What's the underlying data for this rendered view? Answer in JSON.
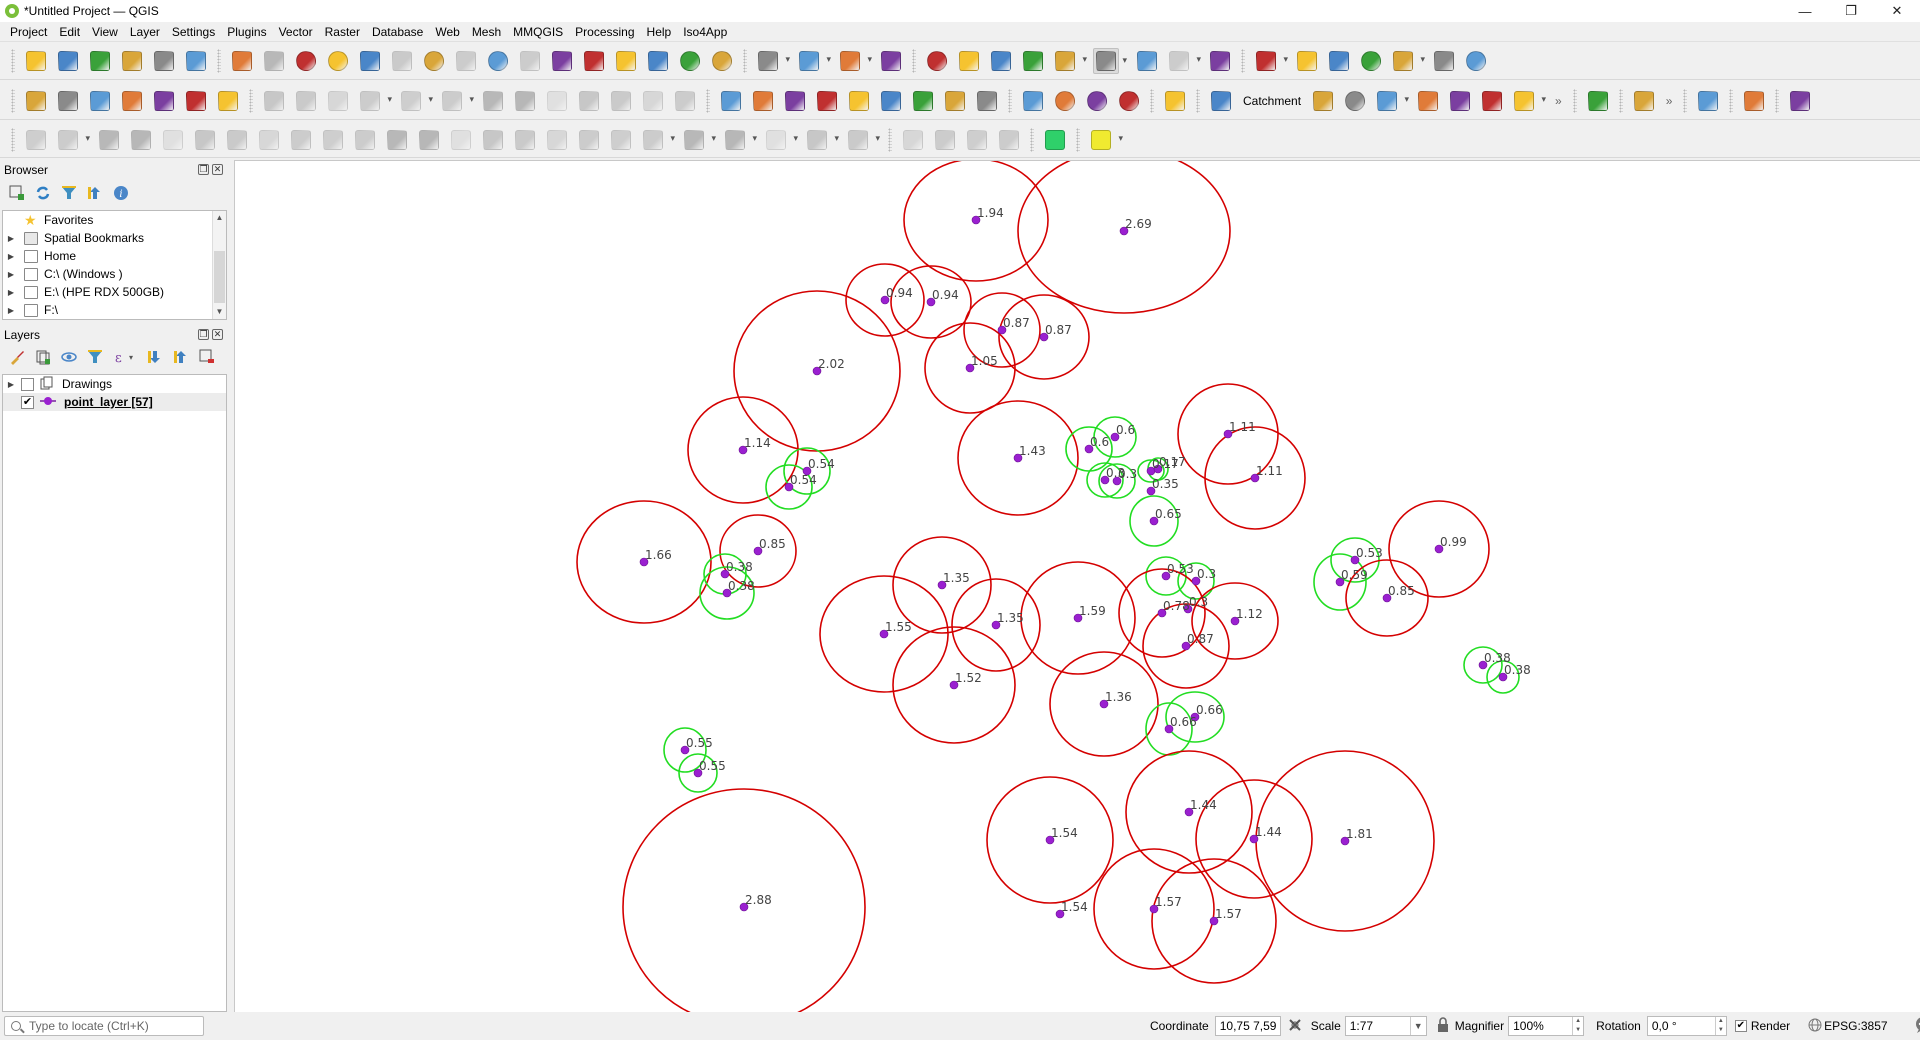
{
  "window": {
    "title": "*Untitled Project — QGIS",
    "controls": {
      "minimize": "—",
      "restore": "❐",
      "close": "✕"
    }
  },
  "menubar": [
    "Project",
    "Edit",
    "View",
    "Layer",
    "Settings",
    "Plugins",
    "Vector",
    "Raster",
    "Database",
    "Web",
    "Mesh",
    "MMQGIS",
    "Processing",
    "Help",
    "Iso4App"
  ],
  "toolbar": {
    "row1_icons": [
      "new-project",
      "open-project",
      "save-project",
      "new-print-layout",
      "layout-manager",
      "style-manager",
      "pan",
      "pan-to-selection",
      "zoom-in",
      "zoom-out",
      "zoom-full",
      "zoom-to-selection",
      "zoom-to-layer",
      "zoom-native",
      "zoom-last",
      "zoom-next",
      "new-map-view",
      "new-3d-map-view",
      "new-bookmark",
      "show-bookmarks",
      "temporal-controller",
      "refresh",
      "select-features",
      "select-by-expression",
      "deselect",
      "select-by-location",
      "identify",
      "open-attribute-table-calc",
      "processing-toolbox",
      "statistical-summary",
      "attribute-table",
      "measure-line",
      "map-tips",
      "locator-filter",
      "whats-this",
      "digitize-point",
      "digitize-line",
      "digitize-rectangle",
      "digitize-circle",
      "digitize-freehand",
      "digitize-polygon",
      "shape-settings"
    ],
    "row2_icons": [
      "data-source-manager",
      "new-geopackage",
      "new-shapefile",
      "new-spatialite",
      "new-virtual-layer",
      "new-temp-scratch",
      "new-mesh",
      "toggle-editing-disabled",
      "current-edits",
      "save-edits",
      "add-line",
      "add-polygon",
      "vertex-tool",
      "modify-attributes",
      "delete-selected",
      "cut",
      "copy",
      "paste",
      "undo",
      "redo",
      "layer-labeling",
      "layer-diagram",
      "pin-labels",
      "show-hide-labels",
      "highlight-pinned",
      "move-label",
      "rotate-label",
      "change-label",
      "label-properties",
      "digitize-polygon-red",
      "quickmapservices-add",
      "quickmapservices-search",
      "geocoding",
      "python-console",
      "catchment-plugin",
      "catchment-label",
      "osgeo-plugin",
      "timer",
      "measure-distance",
      "aggregate",
      "label-tool",
      "binoculars",
      "point-sampling",
      "more",
      "help-book",
      "topology-checker",
      "more2",
      "clipboard-layers",
      "hexagon-plugin",
      "plant-plugin"
    ],
    "catchment_label": "Catchment",
    "row3_icons": [
      "advanced-digitizing",
      "move-point",
      "reshape",
      "offset-curve",
      "rotate-feature",
      "simplify",
      "add-ring",
      "add-part",
      "fill-ring",
      "delete-ring",
      "delete-part",
      "split-features",
      "merge-attributes",
      "vertex-select",
      "split-parts",
      "cut-features",
      "cut-alt",
      "merge-features",
      "line-align",
      "rotate-point",
      "arc-tool",
      "circle-tool",
      "ellipse-tool",
      "rectangle-tool",
      "polygon-tool",
      "trim-extend",
      "reverse-line",
      "flip-tool",
      "delete-vertex",
      "green-shape",
      "layers-yellow"
    ]
  },
  "browser": {
    "title": "Browser",
    "items": [
      {
        "label": "Favorites",
        "icon": "star",
        "expandable": false
      },
      {
        "label": "Spatial Bookmarks",
        "icon": "bookmark",
        "expandable": true
      },
      {
        "label": "Home",
        "icon": "home-folder",
        "expandable": true
      },
      {
        "label": "C:\\ (Windows )",
        "icon": "folder",
        "expandable": true
      },
      {
        "label": "E:\\ (HPE RDX 500GB)",
        "icon": "folder",
        "expandable": true
      },
      {
        "label": "F:\\",
        "icon": "folder",
        "expandable": true
      }
    ]
  },
  "layers": {
    "title": "Layers",
    "items": [
      {
        "label": "Drawings",
        "checked": false,
        "icon": "group",
        "expandable": true
      },
      {
        "label": "point_layer [57]",
        "checked": true,
        "icon": "point-symbol",
        "expandable": false,
        "bold": true
      }
    ]
  },
  "map": {
    "colors": {
      "red_buffer": "#d40000",
      "green_buffer": "#22dd22",
      "point": "#9a20d0",
      "label": "#444444",
      "background": "#ffffff"
    },
    "threshold_note": "Points with value < 0.7 drawn with green buffers, others red",
    "points": [
      {
        "value": "1.94",
        "class": "red"
      },
      {
        "value": "2.69",
        "class": "red"
      },
      {
        "value": "0.94",
        "class": "red"
      },
      {
        "value": "0.94",
        "class": "red"
      },
      {
        "value": "0.87",
        "class": "red"
      },
      {
        "value": "0.87",
        "class": "red"
      },
      {
        "value": "2.02",
        "class": "red"
      },
      {
        "value": "1.05",
        "class": "red"
      },
      {
        "value": "1.14",
        "class": "red"
      },
      {
        "value": "0.54",
        "class": "green"
      },
      {
        "value": "0.54",
        "class": "green"
      },
      {
        "value": "1.43",
        "class": "red"
      },
      {
        "value": "0.6",
        "class": "green"
      },
      {
        "value": "0.6",
        "class": "green"
      },
      {
        "value": "0.3",
        "class": "green"
      },
      {
        "value": "0.3",
        "class": "green"
      },
      {
        "value": "0.17",
        "class": "green"
      },
      {
        "value": "0.17",
        "class": "green"
      },
      {
        "value": "0.35",
        "class": "green"
      },
      {
        "value": "0.65",
        "class": "green"
      },
      {
        "value": "1.11",
        "class": "red"
      },
      {
        "value": "1.11",
        "class": "red"
      },
      {
        "value": "1.66",
        "class": "red"
      },
      {
        "value": "0.85",
        "class": "red"
      },
      {
        "value": "0.38",
        "class": "green"
      },
      {
        "value": "0.38",
        "class": "green"
      },
      {
        "value": "1.35",
        "class": "red"
      },
      {
        "value": "1.35",
        "class": "red"
      },
      {
        "value": "1.55",
        "class": "red"
      },
      {
        "value": "1.52",
        "class": "red"
      },
      {
        "value": "1.59",
        "class": "red"
      },
      {
        "value": "0.53",
        "class": "green"
      },
      {
        "value": "0.3",
        "class": "green"
      },
      {
        "value": "0.3",
        "class": "green"
      },
      {
        "value": "0.78",
        "class": "red"
      },
      {
        "value": "0.87",
        "class": "red"
      },
      {
        "value": "1.12",
        "class": "red"
      },
      {
        "value": "0.53",
        "class": "green"
      },
      {
        "value": "0.59",
        "class": "green"
      },
      {
        "value": "0.99",
        "class": "red"
      },
      {
        "value": "0.85",
        "class": "red"
      },
      {
        "value": "0.38",
        "class": "green"
      },
      {
        "value": "0.38",
        "class": "green"
      },
      {
        "value": "1.36",
        "class": "red"
      },
      {
        "value": "0.66",
        "class": "green"
      },
      {
        "value": "0.66",
        "class": "green"
      },
      {
        "value": "0.55",
        "class": "green"
      },
      {
        "value": "0.55",
        "class": "green"
      },
      {
        "value": "2.88",
        "class": "red"
      },
      {
        "value": "1.54",
        "class": "red"
      },
      {
        "value": "1.54",
        "class": "red"
      },
      {
        "value": "1.44",
        "class": "red"
      },
      {
        "value": "1.44",
        "class": "red"
      },
      {
        "value": "1.81",
        "class": "red"
      },
      {
        "value": "1.57",
        "class": "red"
      },
      {
        "value": "1.57",
        "class": "red"
      }
    ]
  },
  "statusbar": {
    "locator_placeholder": "Type to locate (Ctrl+K)",
    "coordinate_label": "Coordinate",
    "coordinate_value": "10,75 7,59",
    "scale_label": "Scale",
    "scale_value": "1:77",
    "magnifier_label": "Magnifier",
    "magnifier_value": "100%",
    "rotation_label": "Rotation",
    "rotation_value": "0,0 °",
    "render_label": "Render",
    "render_checked": true,
    "crs": "EPSG:3857"
  }
}
